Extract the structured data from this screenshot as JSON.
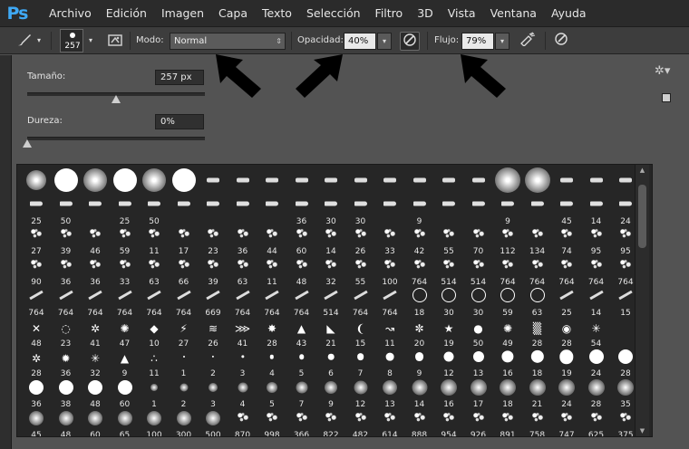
{
  "app": {
    "logo": "Ps"
  },
  "menu": [
    "Archivo",
    "Edición",
    "Imagen",
    "Capa",
    "Texto",
    "Selección",
    "Filtro",
    "3D",
    "Vista",
    "Ventana",
    "Ayuda"
  ],
  "options": {
    "brush_size": "257",
    "mode_label": "Modo:",
    "mode_value": "Normal",
    "opacity_label": "Opacidad:",
    "opacity_value": "40%",
    "flow_label": "Flujo:",
    "flow_value": "79%"
  },
  "brush_panel": {
    "size_label": "Tamaño:",
    "size_value": "257 px",
    "size_fraction": 0.5,
    "hardness_label": "Dureza:",
    "hardness_value": "0%",
    "hardness_fraction": 0.0
  },
  "preset_rows": [
    {
      "kind": "big",
      "labels": [
        "",
        "",
        "",
        "",
        "",
        "",
        "",
        "",
        "",
        "",
        "",
        "",
        "",
        "",
        "",
        "",
        "",
        "",
        "",
        "",
        ""
      ]
    },
    {
      "kind": "tips",
      "labels": [
        "25",
        "50",
        "",
        "25",
        "50",
        "",
        "",
        "",
        "",
        "36",
        "30",
        "30",
        "",
        "9",
        "",
        "",
        "9",
        "",
        "45",
        "14",
        "24"
      ]
    },
    {
      "kind": "spatter",
      "labels": [
        "27",
        "39",
        "46",
        "59",
        "11",
        "17",
        "23",
        "36",
        "44",
        "60",
        "14",
        "26",
        "33",
        "42",
        "55",
        "70",
        "112",
        "134",
        "74",
        "95",
        "95"
      ]
    },
    {
      "kind": "spatter",
      "labels": [
        "90",
        "36",
        "36",
        "33",
        "63",
        "66",
        "39",
        "63",
        "11",
        "48",
        "32",
        "55",
        "100",
        "764",
        "514",
        "514",
        "764",
        "764",
        "764",
        "764",
        "764"
      ]
    },
    {
      "kind": "strokes",
      "labels": [
        "764",
        "764",
        "764",
        "764",
        "764",
        "764",
        "669",
        "764",
        "764",
        "764",
        "514",
        "764",
        "764",
        "18",
        "30",
        "30",
        "59",
        "63",
        "25",
        "14",
        "15"
      ]
    },
    {
      "kind": "shapes",
      "labels": [
        "48",
        "23",
        "41",
        "47",
        "10",
        "27",
        "26",
        "41",
        "28",
        "43",
        "21",
        "15",
        "11",
        "20",
        "19",
        "50",
        "49",
        "28",
        "28",
        "54",
        ""
      ]
    },
    {
      "kind": "dots",
      "labels": [
        "28",
        "36",
        "32",
        "9",
        "11",
        "1",
        "2",
        "3",
        "4",
        "5",
        "6",
        "7",
        "8",
        "9",
        "12",
        "13",
        "16",
        "18",
        "19",
        "24",
        "28"
      ]
    },
    {
      "kind": "soft",
      "labels": [
        "36",
        "38",
        "48",
        "60",
        "1",
        "2",
        "3",
        "4",
        "5",
        "7",
        "9",
        "12",
        "13",
        "14",
        "16",
        "17",
        "18",
        "21",
        "24",
        "28",
        "35"
      ]
    },
    {
      "kind": "mixed",
      "labels": [
        "45",
        "48",
        "60",
        "65",
        "100",
        "300",
        "500",
        "870",
        "998",
        "366",
        "822",
        "482",
        "614",
        "888",
        "954",
        "926",
        "891",
        "758",
        "747",
        "625",
        "375"
      ]
    },
    {
      "kind": "leaf",
      "labels": [
        "",
        "",
        "",
        "",
        "",
        "",
        "",
        "",
        "",
        "",
        "",
        "",
        "",
        "",
        "",
        "",
        "",
        "",
        "",
        "",
        ""
      ]
    }
  ],
  "icons": {
    "brush_tool": "brush-icon",
    "brush_panel_toggle": "brush-panel-icon",
    "airbrush": "airbrush-icon",
    "pressure_opacity": "pressure-opacity-icon",
    "pressure_size": "pressure-size-icon",
    "gear": "gear-icon",
    "new_preset": "new-preset-icon"
  },
  "colors": {
    "accent": "#3fa9f5",
    "menubar": "#2b2b2b",
    "optbar": "#3d3d3d",
    "panel": "#535353",
    "grid_bg": "#262626"
  }
}
